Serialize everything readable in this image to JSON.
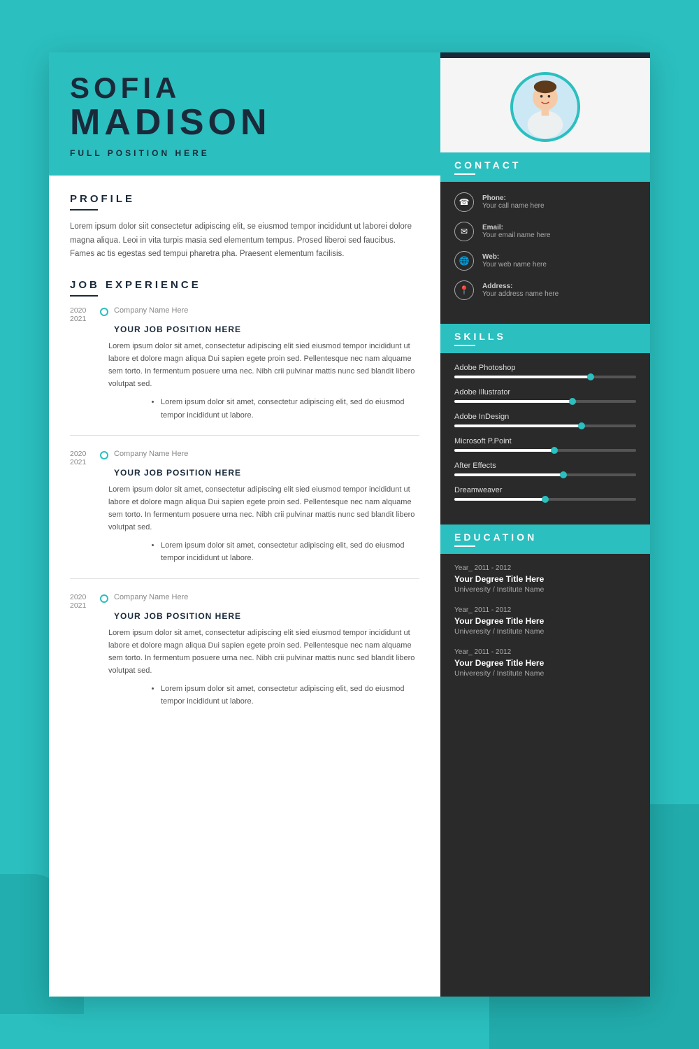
{
  "background": {
    "color": "#2bbfbf"
  },
  "header": {
    "first_name": "SOFIA",
    "last_name": "MADISON",
    "position": "FULL POSITION HERE"
  },
  "profile": {
    "section_title": "PROFILE",
    "text": "Lorem ipsum dolor siit consectetur adipiscing elit, se eiusmod tempor incididunt ut laborei dolore magna aliqua. Leoi in vita turpis masia sed elementum tempus. Prosed liberoi sed faucibus. Fames ac tis egestas sed tempui pharetra pha. Praesent elementum facilisis."
  },
  "job_experience": {
    "section_title": "JOB EXPERIENCE",
    "jobs": [
      {
        "year_start": "2020",
        "year_end": "2021",
        "company": "Company Name Here",
        "position": "YOUR JOB POSITION HERE",
        "description": "Lorem ipsum dolor sit amet, consectetur adipiscing elit sied eiusmod tempor incididunt ut labore et dolore magn  aliqua Dui sapien egete proin sed. Pellentesque nec nam alquame sem torto. In fermentum posuere urna nec. Nibh crii pulvinar mattis nunc sed blandit libero volutpat sed.",
        "bullet": "Lorem ipsum dolor sit amet, consectetur adipiscing elit, sed do eiusmod tempor incididunt ut labore."
      },
      {
        "year_start": "2020",
        "year_end": "2021",
        "company": "Company Name Here",
        "position": "YOUR JOB POSITION HERE",
        "description": "Lorem ipsum dolor sit amet, consectetur adipiscing elit sied eiusmod tempor incididunt ut labore et dolore magn  aliqua Dui sapien egete proin sed. Pellentesque nec nam alquame sem torto. In fermentum posuere urna nec. Nibh crii pulvinar mattis nunc sed blandit libero volutpat sed.",
        "bullet": "Lorem ipsum dolor sit amet, consectetur adipiscing elit, sed do eiusmod tempor incididunt ut labore."
      },
      {
        "year_start": "2020",
        "year_end": "2021",
        "company": "Company Name Here",
        "position": "YOUR JOB POSITION HERE",
        "description": "Lorem ipsum dolor sit amet, consectetur adipiscing elit sied eiusmod tempor incididunt ut labore et dolore magn  aliqua Dui sapien egete proin sed. Pellentesque nec nam alquame sem torto. In fermentum posuere urna nec. Nibh crii pulvinar mattis nunc sed blandit libero volutpat sed.",
        "bullet": "Lorem ipsum dolor sit amet, consectetur adipiscing elit, sed do eiusmod tempor incididunt ut labore."
      }
    ]
  },
  "contact": {
    "section_title": "CONTACT",
    "items": [
      {
        "icon": "☎",
        "label": "Phone:",
        "value": "Your call name here"
      },
      {
        "icon": "✉",
        "label": "Email:",
        "value": "Your email name here"
      },
      {
        "icon": "⊕",
        "label": "Web:",
        "value": "Your web name here"
      },
      {
        "icon": "●",
        "label": "Address:",
        "value": "Your address name here"
      }
    ]
  },
  "skills": {
    "section_title": "SKILLS",
    "items": [
      {
        "name": "Adobe Photoshop",
        "percent": 75
      },
      {
        "name": "Adobe Illustrator",
        "percent": 65
      },
      {
        "name": "Adobe InDesign",
        "percent": 70
      },
      {
        "name": "Microsoft P.Point",
        "percent": 55
      },
      {
        "name": "After Effects",
        "percent": 60
      },
      {
        "name": "Dreamweaver",
        "percent": 50
      }
    ]
  },
  "education": {
    "section_title": "EDUCATION",
    "items": [
      {
        "year": "Year_ 2011 - 2012",
        "degree": "Your Degree Title Here",
        "school": "Univeresity / Institute Name"
      },
      {
        "year": "Year_ 2011 - 2012",
        "degree": "Your Degree Title Here",
        "school": "Univeresity / Institute Name"
      },
      {
        "year": "Year_ 2011 - 2012",
        "degree": "Your Degree Title Here",
        "school": "Univeresity / Institute Name"
      }
    ]
  }
}
